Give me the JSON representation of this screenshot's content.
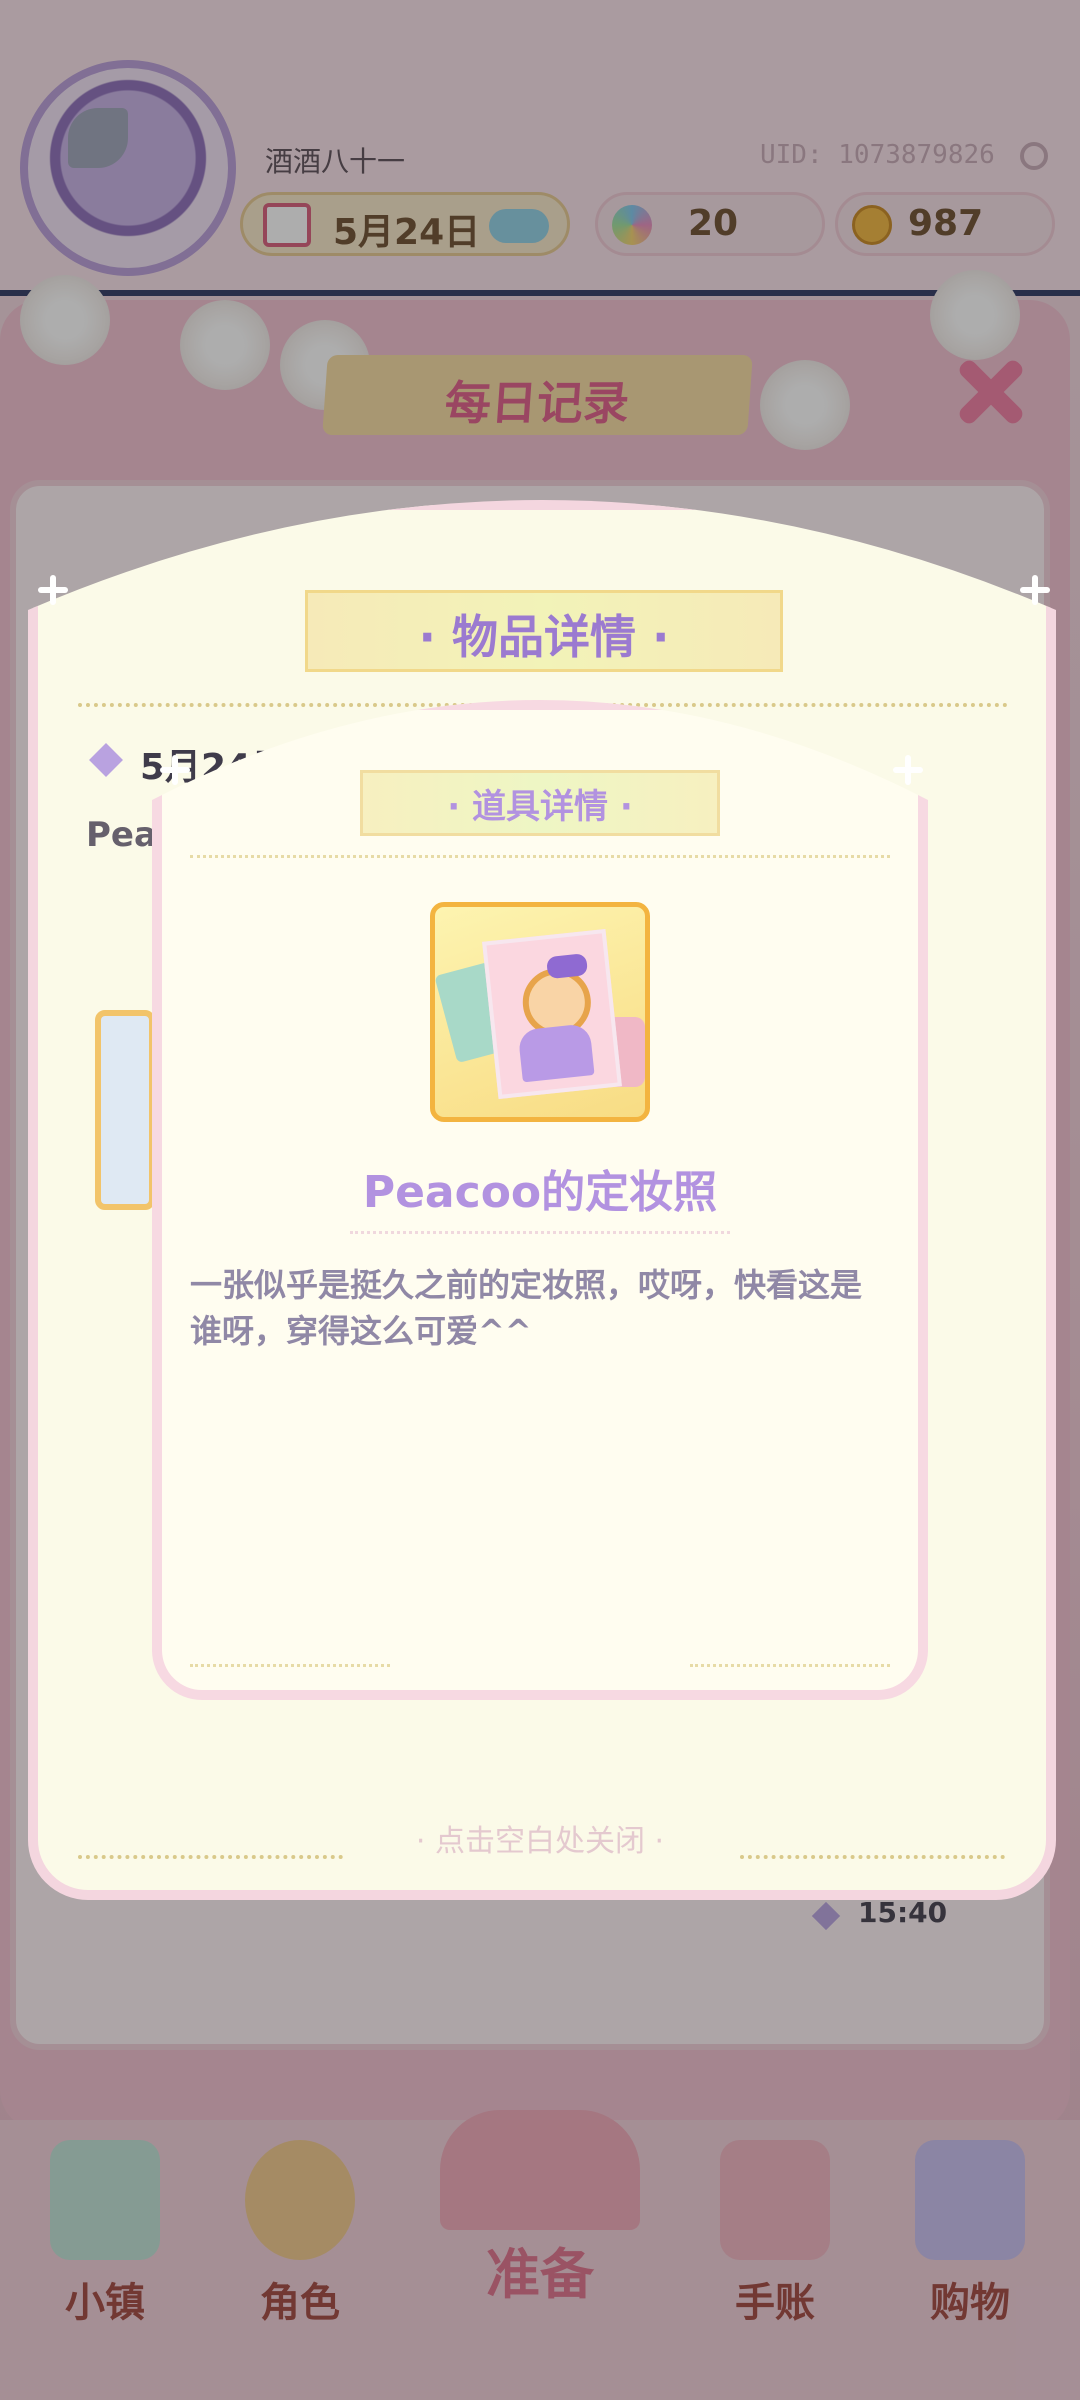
{
  "header": {
    "nickname": "酒酒八十一",
    "uid": "UID: 1073879826",
    "date": "5月24日",
    "gems": "20",
    "coins": "987"
  },
  "record_panel": {
    "title": "每日记录",
    "entry_time": "15:40"
  },
  "item_detail_modal": {
    "title": "· 物品详情 ·",
    "entry_date": "5月24日 14",
    "entry_text_preview": "Peac",
    "close_hint": "· 点击空白处关闭 ·"
  },
  "prop_detail_modal": {
    "title": "· 道具详情 ·",
    "item_name": "Peacoo的定妆照",
    "description": "一张似乎是挺久之前的定妆照，哎呀，快看这是谁呀，穿得这么可爱^^",
    "item_image_icon": "photo-card-icon"
  },
  "bottom_nav": {
    "items": [
      {
        "label": "小镇",
        "icon": "map-icon"
      },
      {
        "label": "角色",
        "icon": "character-icon"
      },
      {
        "label": "准备",
        "icon": "prepare-icon"
      },
      {
        "label": "手账",
        "icon": "journal-icon"
      },
      {
        "label": "购物",
        "icon": "shopping-bag-icon"
      }
    ]
  },
  "colors": {
    "accent_purple": "#b292e0",
    "accent_pink": "#e05a86",
    "dim_overlay": "rgba(40,40,40,0.38)"
  }
}
